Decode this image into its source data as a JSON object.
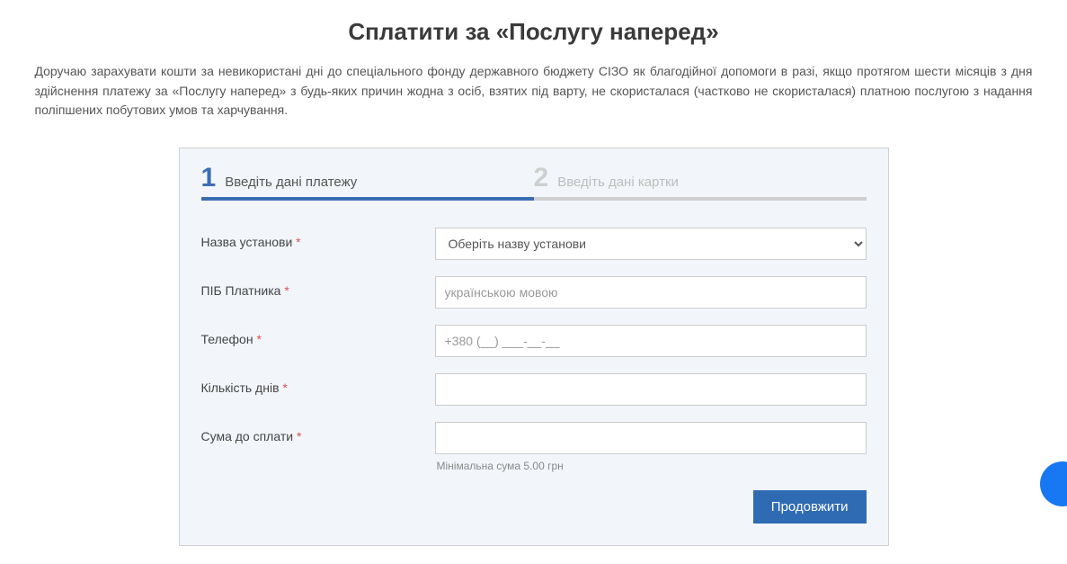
{
  "header": {
    "title": "Сплатити за «Послугу наперед»",
    "intro": "Доручаю зарахувати кошти за невикористані дні до спеціального фонду державного бюджету СІЗО як благодійної допомоги в разі, якщо протягом шести місяців з дня здійснення платежу за «Послугу наперед» з будь-яких причин жодна з осіб, взятих під варту, не скористалася (частково не скористалася) платною послугою з надання поліпшених побутових умов та харчування."
  },
  "steps": {
    "step1_num": "1",
    "step1_label": "Введіть дані платежу",
    "step2_num": "2",
    "step2_label": "Введіть дані картки"
  },
  "form": {
    "institution_label": "Назва установи",
    "institution_placeholder": "Оберіть назву установи",
    "payer_label": "ПІБ Платника",
    "payer_placeholder": "українською мовою",
    "phone_label": "Телефон",
    "phone_placeholder": "+380 (__) ___-__-__",
    "days_label": "Кількість днів",
    "amount_label": "Сума до сплати",
    "amount_hint": "Мінімальна сума 5.00 грн",
    "required_mark": "*"
  },
  "actions": {
    "submit_label": "Продовжити"
  }
}
